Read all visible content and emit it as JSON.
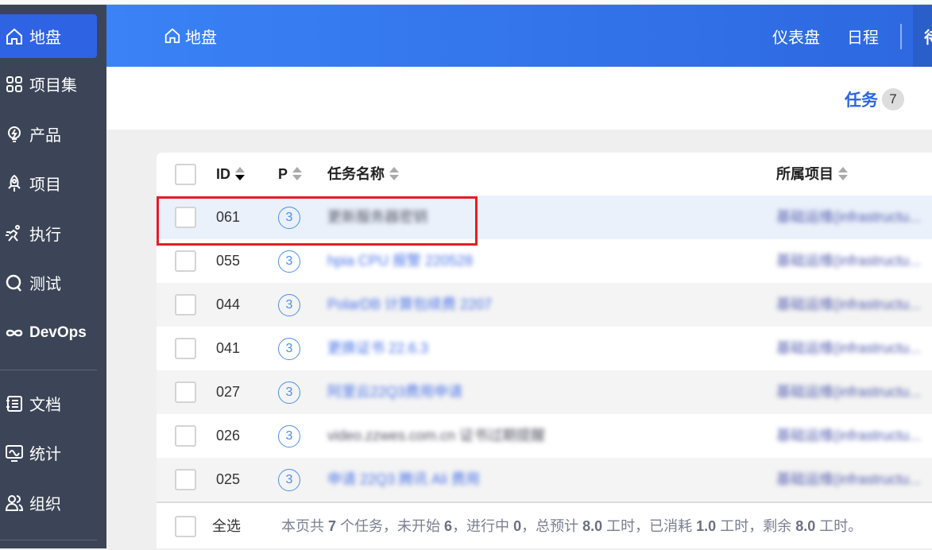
{
  "sidebar": {
    "items": [
      {
        "label": "地盘",
        "icon": "home-icon",
        "active": true
      },
      {
        "label": "项目集",
        "icon": "grid-icon"
      },
      {
        "label": "产品",
        "icon": "lightbulb-icon"
      },
      {
        "label": "项目",
        "icon": "rocket-icon"
      },
      {
        "label": "执行",
        "icon": "running-icon"
      },
      {
        "label": "测试",
        "icon": "search-icon"
      },
      {
        "label": "DevOps",
        "icon": "infinity-icon"
      },
      {
        "label": "文档",
        "icon": "document-icon"
      },
      {
        "label": "统计",
        "icon": "monitor-icon"
      },
      {
        "label": "组织",
        "icon": "users-icon"
      }
    ]
  },
  "header": {
    "breadcrumb": "地盘",
    "nav": [
      "仪表盘",
      "日程"
    ],
    "active_nav": "待办"
  },
  "subnav": {
    "tab": "任务",
    "count": "7"
  },
  "table": {
    "columns": {
      "id": "ID",
      "p": "P",
      "name": "任务名称",
      "project": "所属项目"
    },
    "rows": [
      {
        "id": "061",
        "p": "3",
        "name": "更新服务器密钥",
        "project": "基础运维(infrastructu..."
      },
      {
        "id": "055",
        "p": "3",
        "name": "hpia CPU 报警 220528",
        "project": "基础运维(infrastructu..."
      },
      {
        "id": "044",
        "p": "3",
        "name": "PolarDB 计算包续费 2207",
        "project": "基础运维(infrastructu..."
      },
      {
        "id": "041",
        "p": "3",
        "name": "更换证书 22.6.3",
        "project": "基础运维(infrastructu..."
      },
      {
        "id": "027",
        "p": "3",
        "name": "阿里云22Q3费用申请",
        "project": "基础运维(infrastructu..."
      },
      {
        "id": "026",
        "p": "3",
        "name": "video.zzwes.com.cn 证书过期提醒",
        "project": "基础运维(infrastructu..."
      },
      {
        "id": "025",
        "p": "3",
        "name": "申请 22Q3 腾讯 Ali 费用",
        "project": "基础运维(infrastructu..."
      }
    ]
  },
  "footer": {
    "select_all": "全选",
    "s1": "本页共 ",
    "total": "7",
    "s2": " 个任务，未开始 ",
    "not_started": "6",
    "s3": "，进行中 ",
    "in_progress": "0",
    "s4": "，总预计 ",
    "estimate": "8.0",
    "s5": " 工时，已消耗 ",
    "consumed": "1.0",
    "s6": " 工时，剩余 ",
    "left": "8.0",
    "s7": " 工时。"
  }
}
